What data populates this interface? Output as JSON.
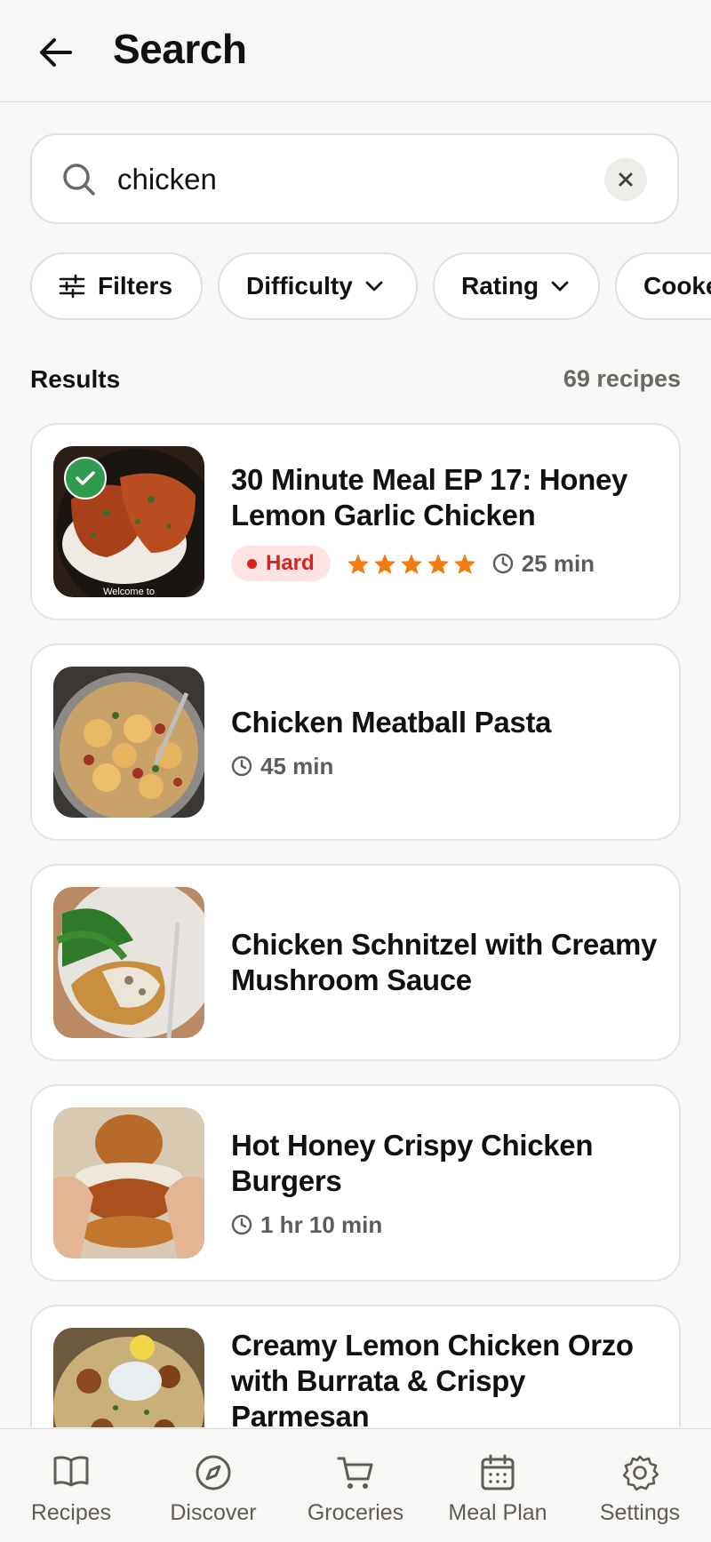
{
  "header": {
    "title": "Search"
  },
  "search": {
    "value": "chicken",
    "placeholder": ""
  },
  "filters": {
    "filters_label": "Filters",
    "difficulty_label": "Difficulty",
    "rating_label": "Rating",
    "cooked_label": "Cooke"
  },
  "results": {
    "label": "Results",
    "count": "69 recipes"
  },
  "recipes": [
    {
      "title": "30 Minute Meal EP 17: Honey Lemon Garlic Chicken",
      "difficulty": "Hard",
      "rating": 5,
      "time": "25 min",
      "selected": true,
      "thumb_caption": "Welcome to"
    },
    {
      "title": "Chicken Meatball Pasta",
      "time": "45 min"
    },
    {
      "title": "Chicken Schnitzel with Creamy Mushroom Sauce"
    },
    {
      "title": "Hot Honey Crispy Chicken Burgers",
      "time": "1 hr 10 min"
    },
    {
      "title": "Creamy Lemon Chicken Orzo with Burrata & Crispy Parmesan"
    }
  ],
  "tabs": [
    {
      "label": "Recipes",
      "icon": "book-icon"
    },
    {
      "label": "Discover",
      "icon": "compass-icon"
    },
    {
      "label": "Groceries",
      "icon": "cart-icon"
    },
    {
      "label": "Meal Plan",
      "icon": "calendar-icon"
    },
    {
      "label": "Settings",
      "icon": "gear-icon"
    }
  ],
  "colors": {
    "accent_difficulty": "#d8231e",
    "star": "#f07c12",
    "selected_check": "#2e9b4f"
  }
}
